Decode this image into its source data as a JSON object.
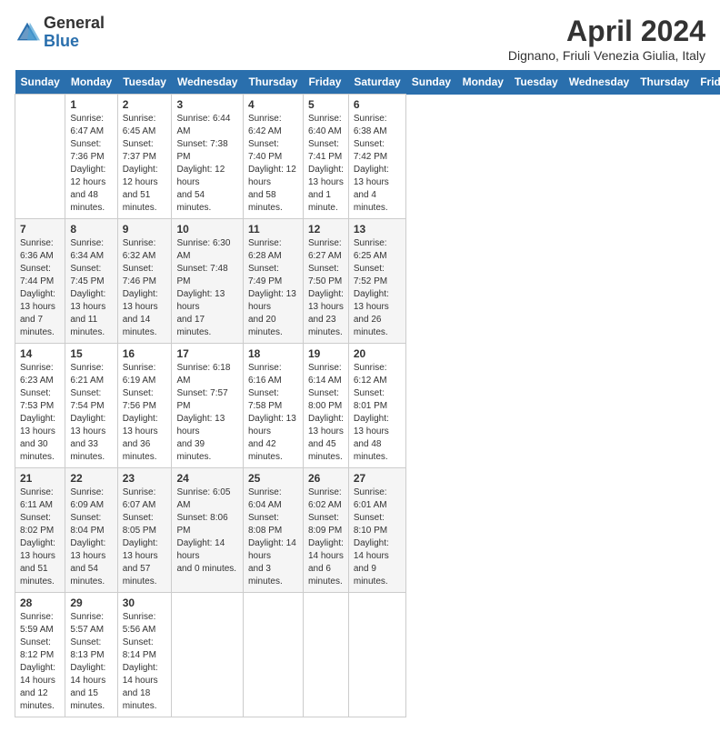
{
  "logo": {
    "general": "General",
    "blue": "Blue"
  },
  "title": "April 2024",
  "subtitle": "Dignano, Friuli Venezia Giulia, Italy",
  "days_of_week": [
    "Sunday",
    "Monday",
    "Tuesday",
    "Wednesday",
    "Thursday",
    "Friday",
    "Saturday"
  ],
  "weeks": [
    [
      {
        "day": "",
        "info": ""
      },
      {
        "day": "1",
        "info": "Sunrise: 6:47 AM\nSunset: 7:36 PM\nDaylight: 12 hours\nand 48 minutes."
      },
      {
        "day": "2",
        "info": "Sunrise: 6:45 AM\nSunset: 7:37 PM\nDaylight: 12 hours\nand 51 minutes."
      },
      {
        "day": "3",
        "info": "Sunrise: 6:44 AM\nSunset: 7:38 PM\nDaylight: 12 hours\nand 54 minutes."
      },
      {
        "day": "4",
        "info": "Sunrise: 6:42 AM\nSunset: 7:40 PM\nDaylight: 12 hours\nand 58 minutes."
      },
      {
        "day": "5",
        "info": "Sunrise: 6:40 AM\nSunset: 7:41 PM\nDaylight: 13 hours\nand 1 minute."
      },
      {
        "day": "6",
        "info": "Sunrise: 6:38 AM\nSunset: 7:42 PM\nDaylight: 13 hours\nand 4 minutes."
      }
    ],
    [
      {
        "day": "7",
        "info": "Sunrise: 6:36 AM\nSunset: 7:44 PM\nDaylight: 13 hours\nand 7 minutes."
      },
      {
        "day": "8",
        "info": "Sunrise: 6:34 AM\nSunset: 7:45 PM\nDaylight: 13 hours\nand 11 minutes."
      },
      {
        "day": "9",
        "info": "Sunrise: 6:32 AM\nSunset: 7:46 PM\nDaylight: 13 hours\nand 14 minutes."
      },
      {
        "day": "10",
        "info": "Sunrise: 6:30 AM\nSunset: 7:48 PM\nDaylight: 13 hours\nand 17 minutes."
      },
      {
        "day": "11",
        "info": "Sunrise: 6:28 AM\nSunset: 7:49 PM\nDaylight: 13 hours\nand 20 minutes."
      },
      {
        "day": "12",
        "info": "Sunrise: 6:27 AM\nSunset: 7:50 PM\nDaylight: 13 hours\nand 23 minutes."
      },
      {
        "day": "13",
        "info": "Sunrise: 6:25 AM\nSunset: 7:52 PM\nDaylight: 13 hours\nand 26 minutes."
      }
    ],
    [
      {
        "day": "14",
        "info": "Sunrise: 6:23 AM\nSunset: 7:53 PM\nDaylight: 13 hours\nand 30 minutes."
      },
      {
        "day": "15",
        "info": "Sunrise: 6:21 AM\nSunset: 7:54 PM\nDaylight: 13 hours\nand 33 minutes."
      },
      {
        "day": "16",
        "info": "Sunrise: 6:19 AM\nSunset: 7:56 PM\nDaylight: 13 hours\nand 36 minutes."
      },
      {
        "day": "17",
        "info": "Sunrise: 6:18 AM\nSunset: 7:57 PM\nDaylight: 13 hours\nand 39 minutes."
      },
      {
        "day": "18",
        "info": "Sunrise: 6:16 AM\nSunset: 7:58 PM\nDaylight: 13 hours\nand 42 minutes."
      },
      {
        "day": "19",
        "info": "Sunrise: 6:14 AM\nSunset: 8:00 PM\nDaylight: 13 hours\nand 45 minutes."
      },
      {
        "day": "20",
        "info": "Sunrise: 6:12 AM\nSunset: 8:01 PM\nDaylight: 13 hours\nand 48 minutes."
      }
    ],
    [
      {
        "day": "21",
        "info": "Sunrise: 6:11 AM\nSunset: 8:02 PM\nDaylight: 13 hours\nand 51 minutes."
      },
      {
        "day": "22",
        "info": "Sunrise: 6:09 AM\nSunset: 8:04 PM\nDaylight: 13 hours\nand 54 minutes."
      },
      {
        "day": "23",
        "info": "Sunrise: 6:07 AM\nSunset: 8:05 PM\nDaylight: 13 hours\nand 57 minutes."
      },
      {
        "day": "24",
        "info": "Sunrise: 6:05 AM\nSunset: 8:06 PM\nDaylight: 14 hours\nand 0 minutes."
      },
      {
        "day": "25",
        "info": "Sunrise: 6:04 AM\nSunset: 8:08 PM\nDaylight: 14 hours\nand 3 minutes."
      },
      {
        "day": "26",
        "info": "Sunrise: 6:02 AM\nSunset: 8:09 PM\nDaylight: 14 hours\nand 6 minutes."
      },
      {
        "day": "27",
        "info": "Sunrise: 6:01 AM\nSunset: 8:10 PM\nDaylight: 14 hours\nand 9 minutes."
      }
    ],
    [
      {
        "day": "28",
        "info": "Sunrise: 5:59 AM\nSunset: 8:12 PM\nDaylight: 14 hours\nand 12 minutes."
      },
      {
        "day": "29",
        "info": "Sunrise: 5:57 AM\nSunset: 8:13 PM\nDaylight: 14 hours\nand 15 minutes."
      },
      {
        "day": "30",
        "info": "Sunrise: 5:56 AM\nSunset: 8:14 PM\nDaylight: 14 hours\nand 18 minutes."
      },
      {
        "day": "",
        "info": ""
      },
      {
        "day": "",
        "info": ""
      },
      {
        "day": "",
        "info": ""
      },
      {
        "day": "",
        "info": ""
      }
    ]
  ]
}
